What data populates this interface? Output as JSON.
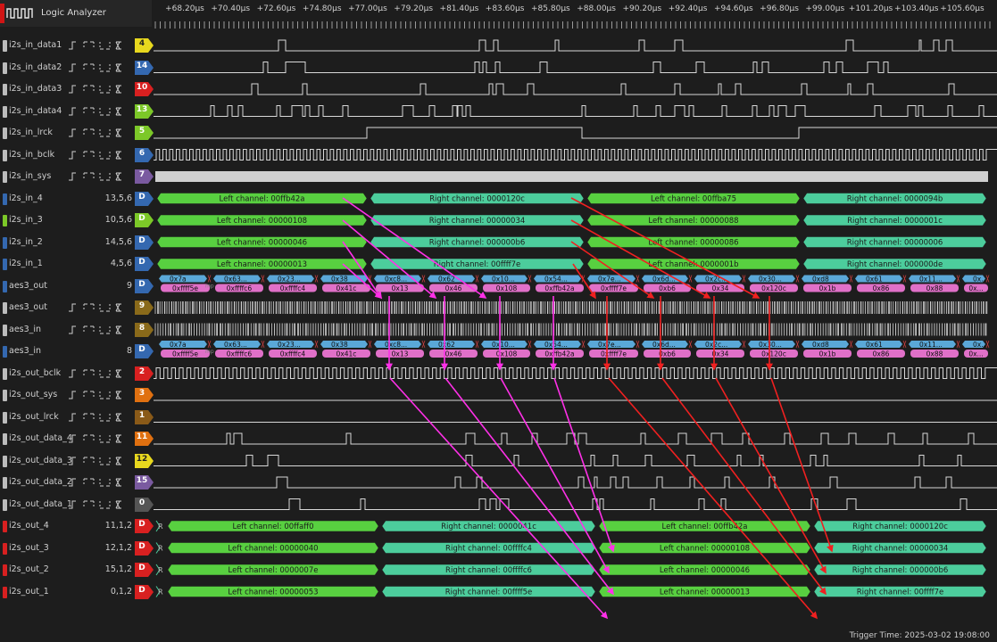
{
  "app": {
    "title": "Logic Analyzer"
  },
  "ruler": {
    "labels": [
      "+68.20µs",
      "+70.40µs",
      "+72.60µs",
      "+74.80µs",
      "+77.00µs",
      "+79.20µs",
      "+81.40µs",
      "+83.60µs",
      "+85.80µs",
      "+88.00µs",
      "+90.20µs",
      "+92.40µs",
      "+94.60µs",
      "+96.80µs",
      "+99.00µs",
      "+101.20µs",
      "+103.40µs",
      "+105.60µs"
    ]
  },
  "channels": [
    {
      "name": "i2s_in_data1",
      "badge": "4",
      "color": "#e8d81e",
      "value": "",
      "kind": "digital"
    },
    {
      "name": "i2s_in_data2",
      "badge": "14",
      "color": "#3468b0",
      "value": "",
      "kind": "digital"
    },
    {
      "name": "i2s_in_data3",
      "badge": "10",
      "color": "#d82020",
      "value": "",
      "kind": "digital"
    },
    {
      "name": "i2s_in_data4",
      "badge": "13",
      "color": "#7cc828",
      "value": "",
      "kind": "digital"
    },
    {
      "name": "i2s_in_lrck",
      "badge": "5",
      "color": "#7cc828",
      "value": "",
      "kind": "digital"
    },
    {
      "name": "i2s_in_bclk",
      "badge": "6",
      "color": "#3468b0",
      "value": "",
      "kind": "digital"
    },
    {
      "name": "i2s_in_sys",
      "badge": "7",
      "color": "#7a5aa0",
      "value": "",
      "kind": "digital"
    },
    {
      "name": "i2s_in_4",
      "badge": "D",
      "color": "#3468b0",
      "value": "13,5,6",
      "kind": "bus"
    },
    {
      "name": "i2s_in_3",
      "badge": "D",
      "color": "#7cc828",
      "value": "10,5,6",
      "kind": "bus"
    },
    {
      "name": "i2s_in_2",
      "badge": "D",
      "color": "#3468b0",
      "value": "14,5,6",
      "kind": "bus"
    },
    {
      "name": "i2s_in_1",
      "badge": "D",
      "color": "#3468b0",
      "value": "4,5,6",
      "kind": "bus"
    },
    {
      "name": "aes3_out",
      "badge": "D",
      "color": "#3468b0",
      "value": "9",
      "kind": "aes"
    },
    {
      "name": "aes3_out",
      "badge": "9",
      "color": "#8a6a1a",
      "value": "",
      "kind": "digital"
    },
    {
      "name": "aes3_in",
      "badge": "8",
      "color": "#8a6a1a",
      "value": "",
      "kind": "digital"
    },
    {
      "name": "aes3_in",
      "badge": "D",
      "color": "#3468b0",
      "value": "8",
      "kind": "aes"
    },
    {
      "name": "i2s_out_bclk",
      "badge": "2",
      "color": "#d82020",
      "value": "",
      "kind": "digital"
    },
    {
      "name": "i2s_out_sys",
      "badge": "3",
      "color": "#e07010",
      "value": "",
      "kind": "digital"
    },
    {
      "name": "i2s_out_lrck",
      "badge": "1",
      "color": "#8a5a18",
      "value": "",
      "kind": "digital"
    },
    {
      "name": "i2s_out_data_4",
      "badge": "11",
      "color": "#e07010",
      "value": "",
      "kind": "digital"
    },
    {
      "name": "i2s_out_data_3",
      "badge": "12",
      "color": "#e8d81e",
      "value": "",
      "kind": "digital"
    },
    {
      "name": "i2s_out_data_2",
      "badge": "15",
      "color": "#7a5aa0",
      "value": "",
      "kind": "digital"
    },
    {
      "name": "i2s_out_data_1",
      "badge": "0",
      "color": "#555555",
      "value": "",
      "kind": "digital"
    },
    {
      "name": "i2s_out_4",
      "badge": "D",
      "color": "#d82020",
      "value": "11,1,2",
      "kind": "bus"
    },
    {
      "name": "i2s_out_3",
      "badge": "D",
      "color": "#d82020",
      "value": "12,1,2",
      "kind": "bus"
    },
    {
      "name": "i2s_out_2",
      "badge": "D",
      "color": "#d82020",
      "value": "15,1,2",
      "kind": "bus"
    },
    {
      "name": "i2s_out_1",
      "badge": "D",
      "color": "#d82020",
      "value": "0,1,2",
      "kind": "bus"
    }
  ],
  "buses": {
    "i2s_in_4": [
      "Left channel: 00ffb42a",
      "Right channel: 0000120c",
      "Left channel: 00ffba75",
      "Right channel: 0000094b"
    ],
    "i2s_in_3": [
      "Left channel: 00000108",
      "Right channel: 00000034",
      "Left channel: 00000088",
      "Right channel: 0000001c"
    ],
    "i2s_in_2": [
      "Left channel: 00000046",
      "Right channel: 000000b6",
      "Left channel: 00000086",
      "Right channel: 00000006"
    ],
    "i2s_in_1": [
      "Left channel: 00000013",
      "Right channel: 00ffff7e",
      "Left channel: 0000001b",
      "Right channel: 000000de"
    ],
    "i2s_out_4": [
      "Left channel: 00ffaff0",
      "Right channel: 0000041c",
      "Left channel: 00ffb42a",
      "Right channel: 0000120c"
    ],
    "i2s_out_3": [
      "Left channel: 00000040",
      "Right channel: 00ffffc4",
      "Left channel: 00000108",
      "Right channel: 00000034"
    ],
    "i2s_out_2": [
      "Left channel: 0000007e",
      "Right channel: 00ffffc6",
      "Left channel: 00000046",
      "Right channel: 000000b6"
    ],
    "i2s_out_1": [
      "Left channel: 00000053",
      "Right channel: 00ffff5e",
      "Left channel: 00000013",
      "Right channel: 00ffff7e"
    ]
  },
  "aes": {
    "top": [
      "0x7a",
      "0x63...",
      "0x23...",
      "0x38",
      "0xc8...",
      "0x62",
      "0x10...",
      "0x54...",
      "0x7e...",
      "0x6d...",
      "0x2c...",
      "0x30...",
      "0xd8",
      "0x61",
      "0x11...",
      "0x..."
    ],
    "bottom": [
      "0xffff5e",
      "0xffffc6",
      "0xffffc4",
      "0x41c",
      "0x13",
      "0x46",
      "0x108",
      "0xffb42a",
      "0xffff7e",
      "0xb6",
      "0x34",
      "0x120c",
      "0x1b",
      "0x86",
      "0x88",
      "0x..."
    ],
    "fragment": "mp"
  },
  "trigger": "Trigger Time: 2025-03-02 19:08:00"
}
